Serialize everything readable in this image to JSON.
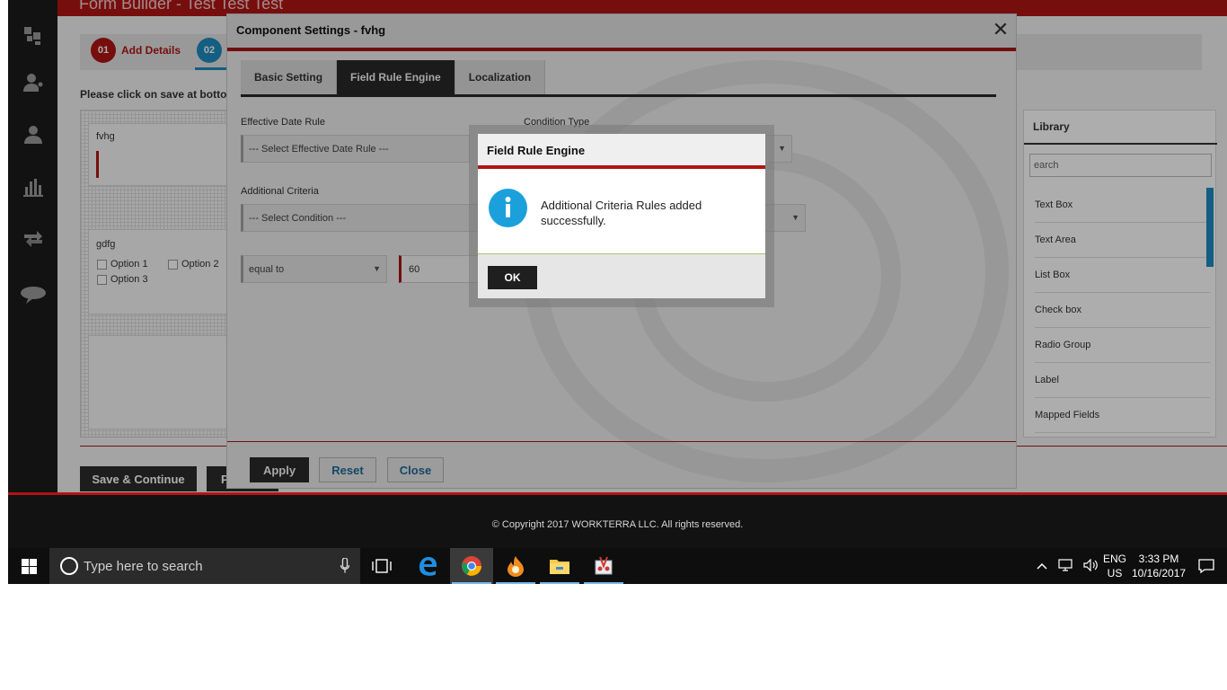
{
  "app": {
    "title": "Form Builder - Test Test Test",
    "steps": [
      {
        "num": "01",
        "label": "Add Details"
      },
      {
        "num": "02",
        "label": ""
      }
    ],
    "hint": "Please click on save at botton",
    "fields": [
      {
        "label": "fvhg"
      },
      {
        "label": "gdfg",
        "options": [
          "Option 1",
          "Option 2",
          "Option 3"
        ]
      }
    ],
    "buttons": {
      "save_continue": "Save & Continue",
      "partial": "P"
    },
    "library": {
      "title": "Library",
      "search_placeholder": "earch",
      "items": [
        "Text Box",
        "Text Area",
        "List Box",
        "Check box",
        "Radio Group",
        "Label",
        "Mapped Fields"
      ]
    },
    "footer": "© Copyright 2017 WORKTERRA LLC. All rights reserved."
  },
  "modal": {
    "title": "Component Settings - fvhg",
    "tabs": [
      "Basic Setting",
      "Field Rule Engine",
      "Localization"
    ],
    "active_tab": "Field Rule Engine",
    "effective_date_label": "Effective Date Rule",
    "effective_date_value": "--- Select Effective Date Rule ---",
    "condition_type_label": "Condition Type",
    "additional_criteria_label": "Additional Criteria",
    "condition_value": "--- Select Condition ---",
    "operator_value": "equal to",
    "value_input": "60",
    "buttons": {
      "apply": "Apply",
      "reset": "Reset",
      "close": "Close"
    }
  },
  "alert": {
    "title": "Field Rule Engine",
    "message": "Additional Criteria Rules added successfully.",
    "ok": "OK"
  },
  "taskbar": {
    "search_placeholder": "Type here to search",
    "lang_top": "ENG",
    "lang_bottom": "US",
    "time": "3:33 PM",
    "date": "10/16/2017"
  },
  "colors": {
    "accent_red": "#b01515",
    "info_blue": "#1ba0dc",
    "step_blue": "#1d8bc0"
  }
}
